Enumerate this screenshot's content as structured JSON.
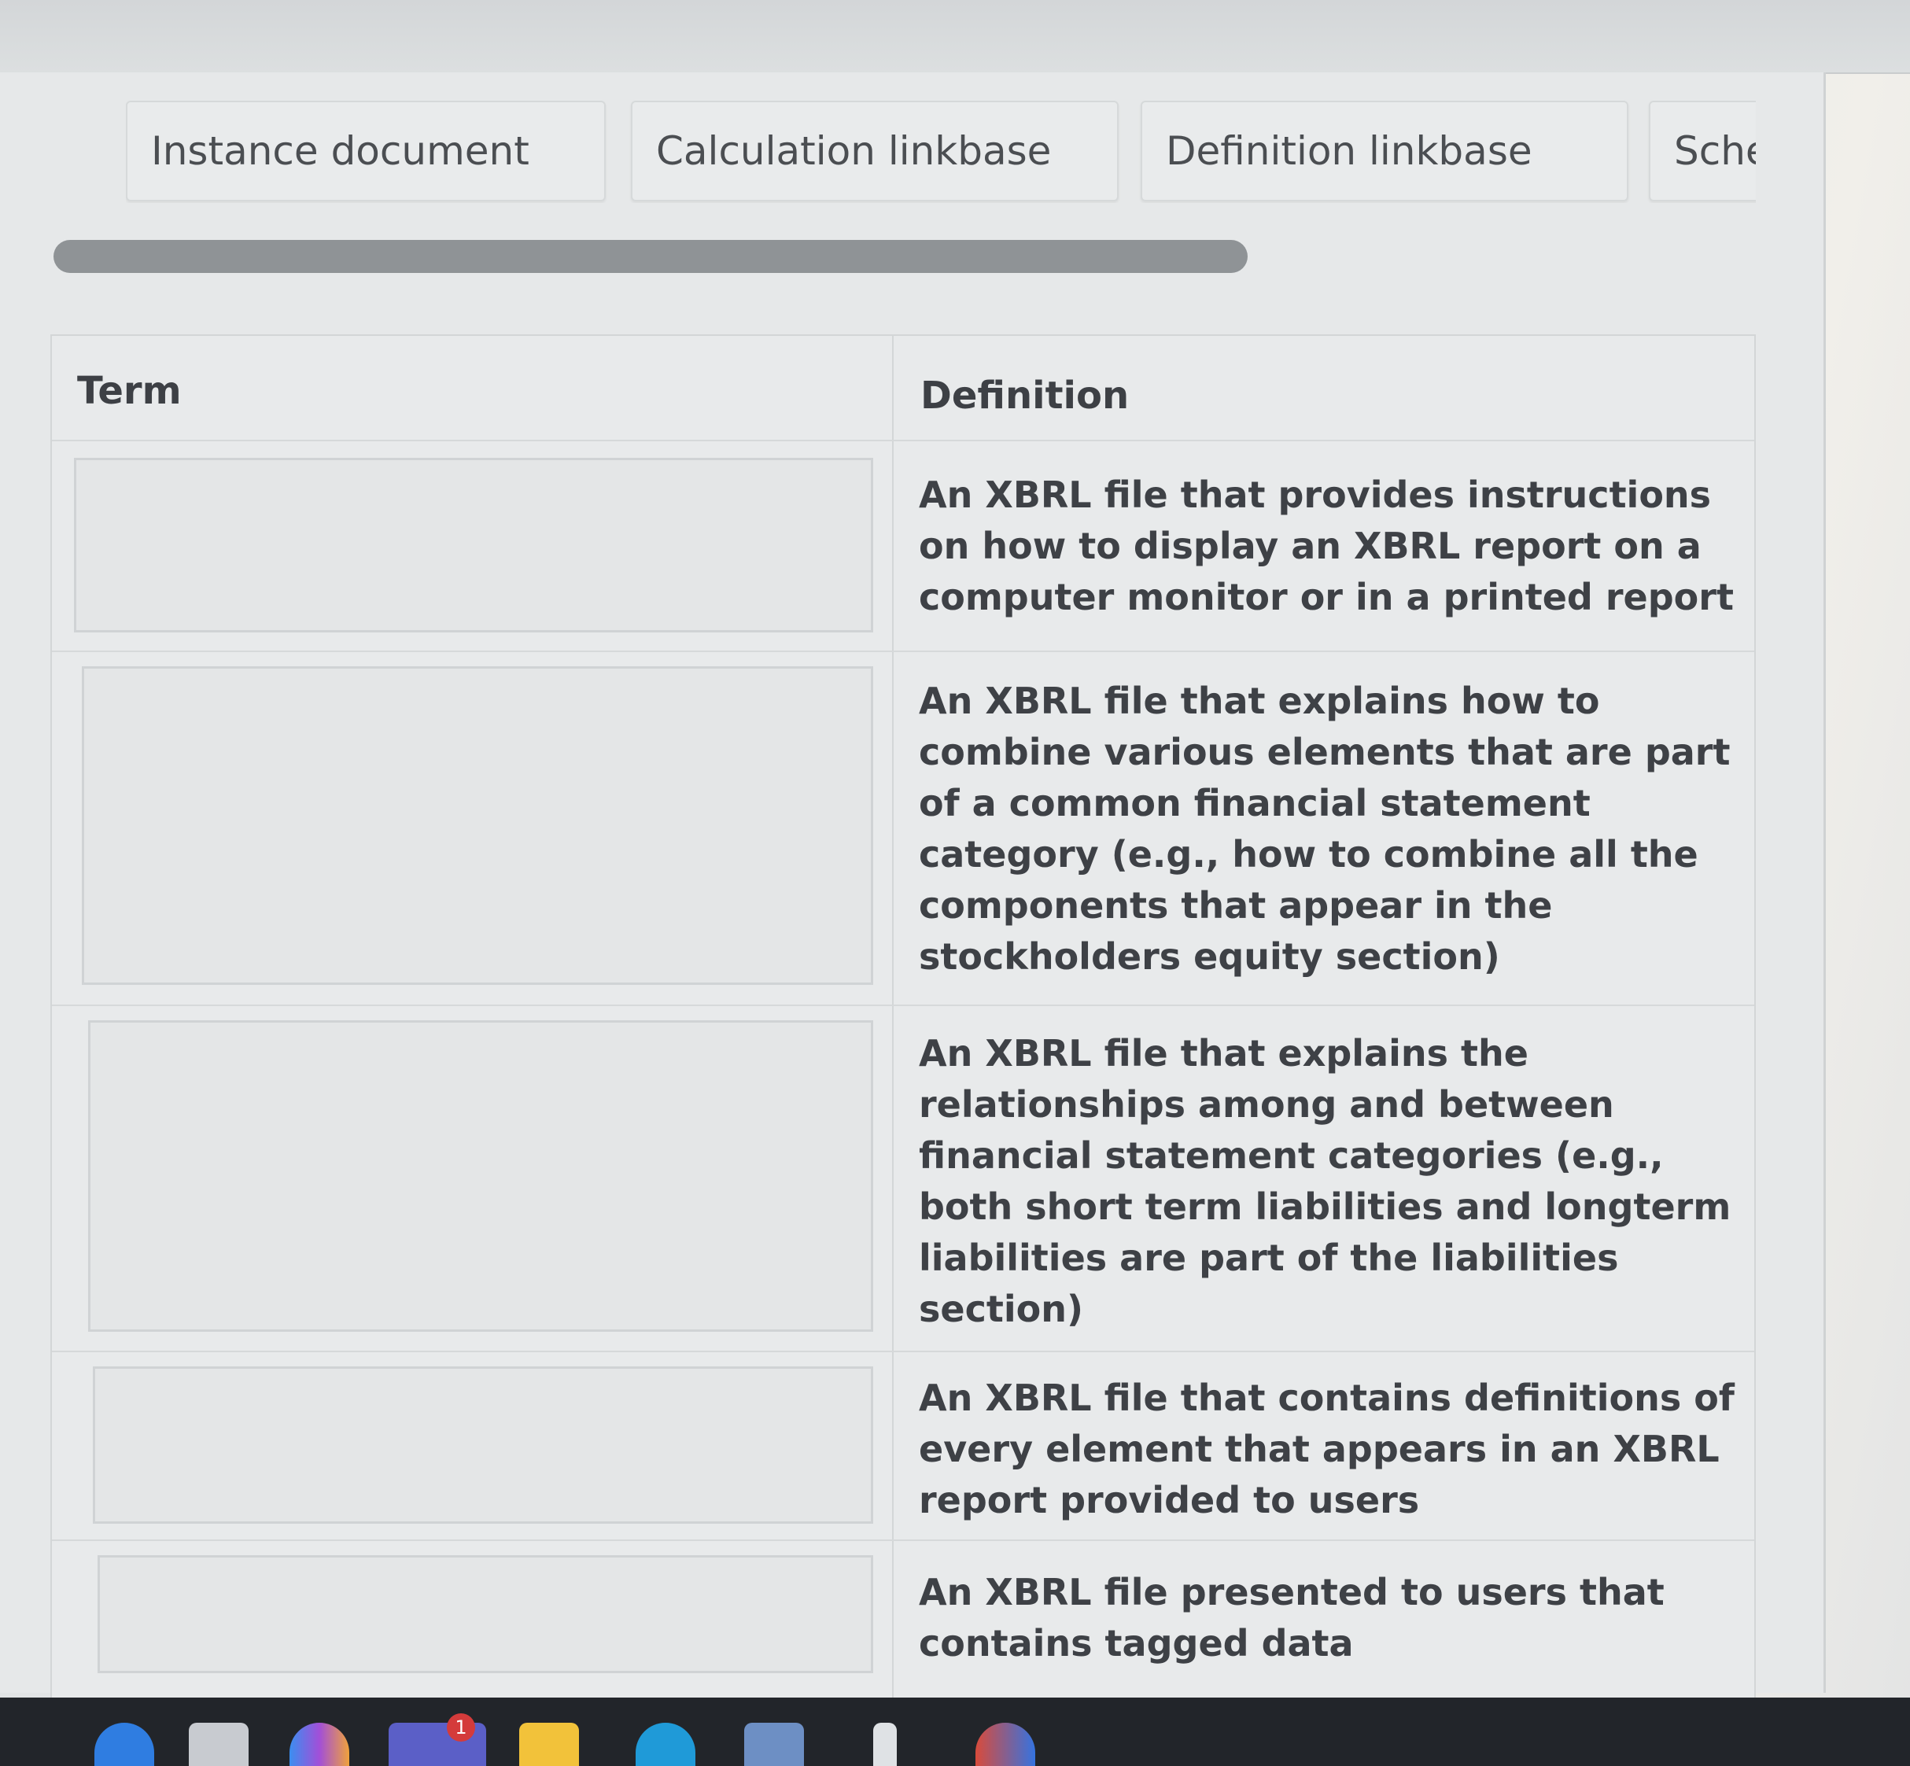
{
  "tabs": [
    {
      "label": "Instance document"
    },
    {
      "label": "Calculation linkbase"
    },
    {
      "label": "Definition linkbase"
    },
    {
      "label": "Sche"
    }
  ],
  "table": {
    "headers": {
      "term": "Term",
      "definition": "Definition"
    },
    "rows": [
      {
        "term": "",
        "definition": "An XBRL file that provides instructions on how to display an XBRL report on a computer monitor or in a printed report"
      },
      {
        "term": "",
        "definition": "An XBRL file that explains how to combine various elements that are part of a common financial statement category (e.g., how to combine all the components that appear in the stockholders equity section)"
      },
      {
        "term": "",
        "definition": "An XBRL file that explains the relationships among and between financial statement categories (e.g., both short term liabilities and longterm liabilities are part of the liabilities section)"
      },
      {
        "term": "",
        "definition": "An XBRL file that contains definitions of every element that appears in an XBRL report provided to users"
      },
      {
        "term": "",
        "definition": "An XBRL file presented to users that contains tagged data"
      }
    ]
  },
  "taskbar": {
    "notification_badge": "1",
    "icons": [
      "copilot-icon",
      "files-icon",
      "edge-icon",
      "teams-icon",
      "folder-icon",
      "browser-icon",
      "calendar-icon",
      "pen-icon",
      "chrome-icon"
    ]
  },
  "colors": {
    "text": "#3e4146",
    "tab_text": "#4b4e52",
    "scrollbar": "#8f9396"
  }
}
